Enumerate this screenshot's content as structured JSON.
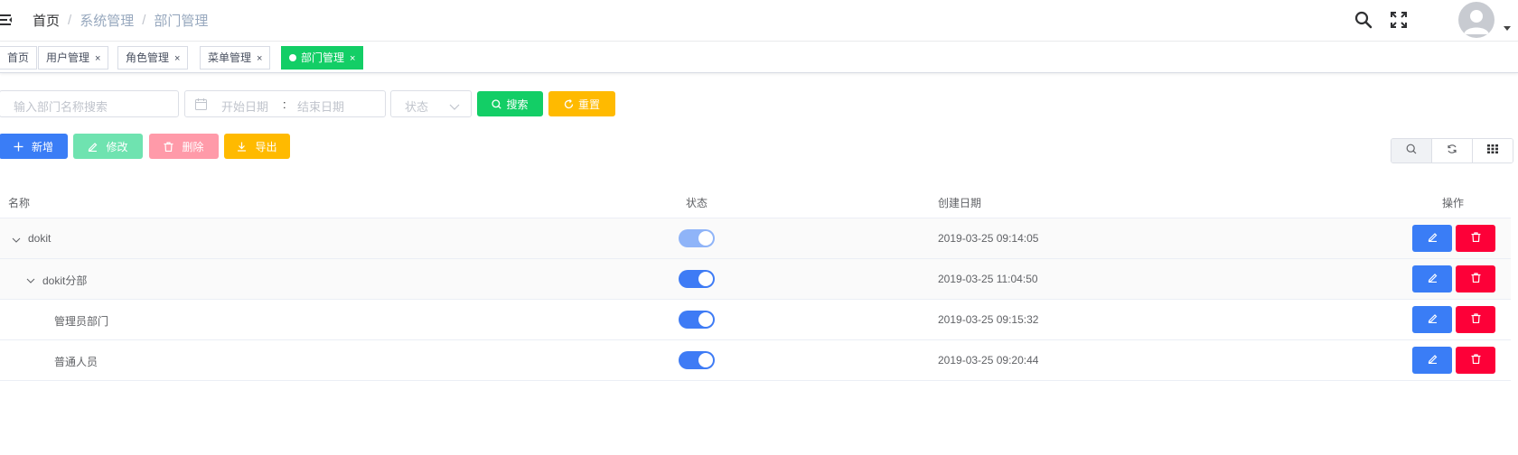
{
  "header": {
    "breadcrumb": [
      "首页",
      "系统管理",
      "部门管理"
    ],
    "separator": "/"
  },
  "tags": [
    {
      "label": "首页",
      "closable": false,
      "active": false
    },
    {
      "label": "用户管理",
      "closable": true,
      "active": false
    },
    {
      "label": "角色管理",
      "closable": true,
      "active": false
    },
    {
      "label": "菜单管理",
      "closable": true,
      "active": false
    },
    {
      "label": "部门管理",
      "closable": true,
      "active": true
    }
  ],
  "tag_close": "×",
  "filters": {
    "name_placeholder": "输入部门名称搜索",
    "start_placeholder": "开始日期",
    "range_separator": ":",
    "end_placeholder": "结束日期",
    "status_placeholder": "状态",
    "search_label": "搜索",
    "reset_label": "重置"
  },
  "actions": {
    "add_label": "新增",
    "edit_label": "修改",
    "delete_label": "删除",
    "export_label": "导出"
  },
  "table": {
    "columns": [
      "名称",
      "状态",
      "创建日期",
      "操作"
    ],
    "rows": [
      {
        "name": "dokit",
        "level": 0,
        "expandable": true,
        "enabled": true,
        "created": "2019-03-25 09:14:05"
      },
      {
        "name": "dokit分部",
        "level": 1,
        "expandable": true,
        "enabled": true,
        "created": "2019-03-25 11:04:50"
      },
      {
        "name": "管理员部门",
        "level": 2,
        "expandable": false,
        "enabled": true,
        "created": "2019-03-25 09:15:32"
      },
      {
        "name": "普通人员",
        "level": 2,
        "expandable": false,
        "enabled": true,
        "created": "2019-03-25 09:20:44"
      }
    ]
  },
  "colors": {
    "primary": "#3a7df6",
    "success": "#13ce66",
    "warning": "#ffba00",
    "danger": "#fd0038",
    "edit_disabled": "#6fe3b0",
    "delete_disabled": "#ff9aa9"
  },
  "icons": {
    "hamburger": "hamburger-icon",
    "search": "search-icon",
    "fullscreen": "fullscreen-icon",
    "avatar": "user-avatar",
    "calendar": "calendar-icon",
    "chevron": "chevron-down-icon",
    "refresh": "refresh-icon",
    "plus": "plus-icon",
    "edit": "edit-icon",
    "delete": "trash-icon",
    "download": "download-icon",
    "grid": "grid-icon"
  }
}
